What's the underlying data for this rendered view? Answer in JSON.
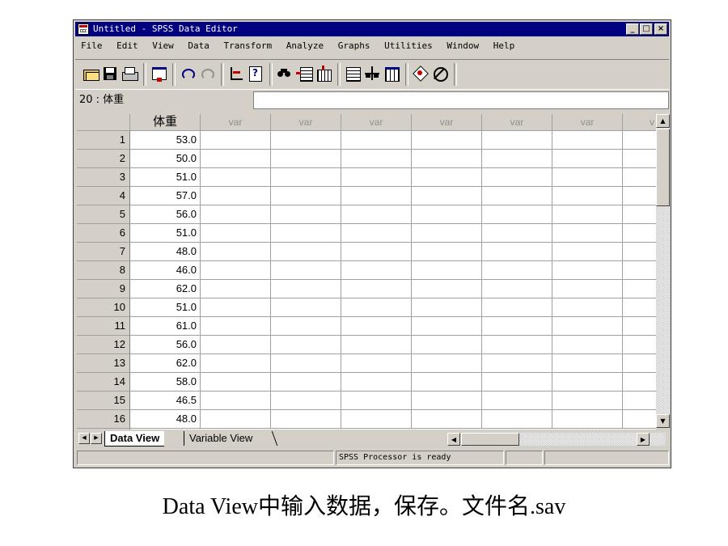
{
  "window": {
    "title": "Untitled - SPSS Data Editor",
    "controls": {
      "minimize": "_",
      "maximize": "□",
      "close": "×"
    }
  },
  "menu": [
    "File",
    "Edit",
    "View",
    "Data",
    "Transform",
    "Analyze",
    "Graphs",
    "Utilities",
    "Window",
    "Help"
  ],
  "toolbar_icons": [
    "open-file-icon",
    "save-icon",
    "print-icon",
    "dialog-recall-icon",
    "undo-icon",
    "redo-icon",
    "goto-chart-icon",
    "goto-case-icon",
    "find-icon",
    "insert-case-icon",
    "insert-variable-icon",
    "split-file-icon",
    "weight-cases-icon",
    "select-cases-icon",
    "value-labels-icon",
    "use-sets-icon"
  ],
  "cell_reference": "20 : 体重",
  "cell_editor_value": "",
  "grid": {
    "columns": [
      "体重",
      "var",
      "var",
      "var",
      "var",
      "var",
      "var",
      "v"
    ],
    "rows": [
      {
        "n": "1",
        "v": "53.0"
      },
      {
        "n": "2",
        "v": "50.0"
      },
      {
        "n": "3",
        "v": "51.0"
      },
      {
        "n": "4",
        "v": "57.0"
      },
      {
        "n": "5",
        "v": "56.0"
      },
      {
        "n": "6",
        "v": "51.0"
      },
      {
        "n": "7",
        "v": "48.0"
      },
      {
        "n": "8",
        "v": "46.0"
      },
      {
        "n": "9",
        "v": "62.0"
      },
      {
        "n": "10",
        "v": "51.0"
      },
      {
        "n": "11",
        "v": "61.0"
      },
      {
        "n": "12",
        "v": "56.0"
      },
      {
        "n": "13",
        "v": "62.0"
      },
      {
        "n": "14",
        "v": "58.0"
      },
      {
        "n": "15",
        "v": "46.5"
      },
      {
        "n": "16",
        "v": "48.0"
      }
    ]
  },
  "tabs": {
    "data_view": "Data View",
    "variable_view": "Variable View"
  },
  "status": {
    "processor": "SPSS Processor  is ready"
  },
  "caption": "Data View中输入数据，保存。文件名.sav"
}
